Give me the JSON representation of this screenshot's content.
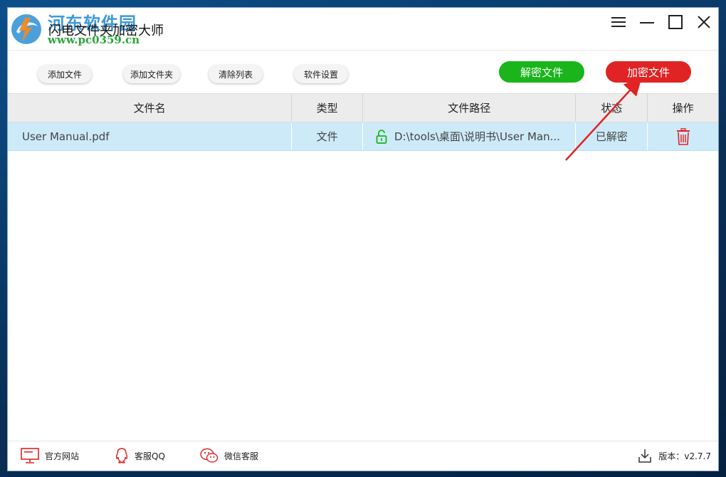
{
  "window": {
    "title": "闪电文件夹加密大师",
    "watermark_name": "河东软件园",
    "watermark_url": "www.pc0359.cn"
  },
  "toolbar": {
    "add_file": "添加文件",
    "add_folder": "添加文件夹",
    "clear_list": "清除列表",
    "settings": "软件设置",
    "decrypt": "解密文件",
    "encrypt": "加密文件"
  },
  "table": {
    "headers": [
      "文件名",
      "类型",
      "文件路径",
      "状态",
      "操作"
    ],
    "rows": [
      {
        "name": "User Manual.pdf",
        "type": "文件",
        "path": "D:\\tools\\桌面\\说明书\\User Man...",
        "status": "已解密"
      }
    ]
  },
  "footer": {
    "website": "官方网站",
    "qq": "客服QQ",
    "wechat": "微信客服",
    "version": "版本：v2.7.7"
  },
  "colors": {
    "decrypt_button": "#19b51b",
    "encrypt_button": "#e02323",
    "selected_row": "#cdeaf8",
    "icon_red": "#e02323",
    "annotation_arrow": "#e02323"
  },
  "icons": {
    "app_logo": "app-logo-icon",
    "lock_open": "lock-open-icon",
    "trash": "trash-icon",
    "monitor": "monitor-icon",
    "qq": "qq-penguin-icon",
    "wechat": "wechat-icon",
    "download": "download-icon"
  }
}
